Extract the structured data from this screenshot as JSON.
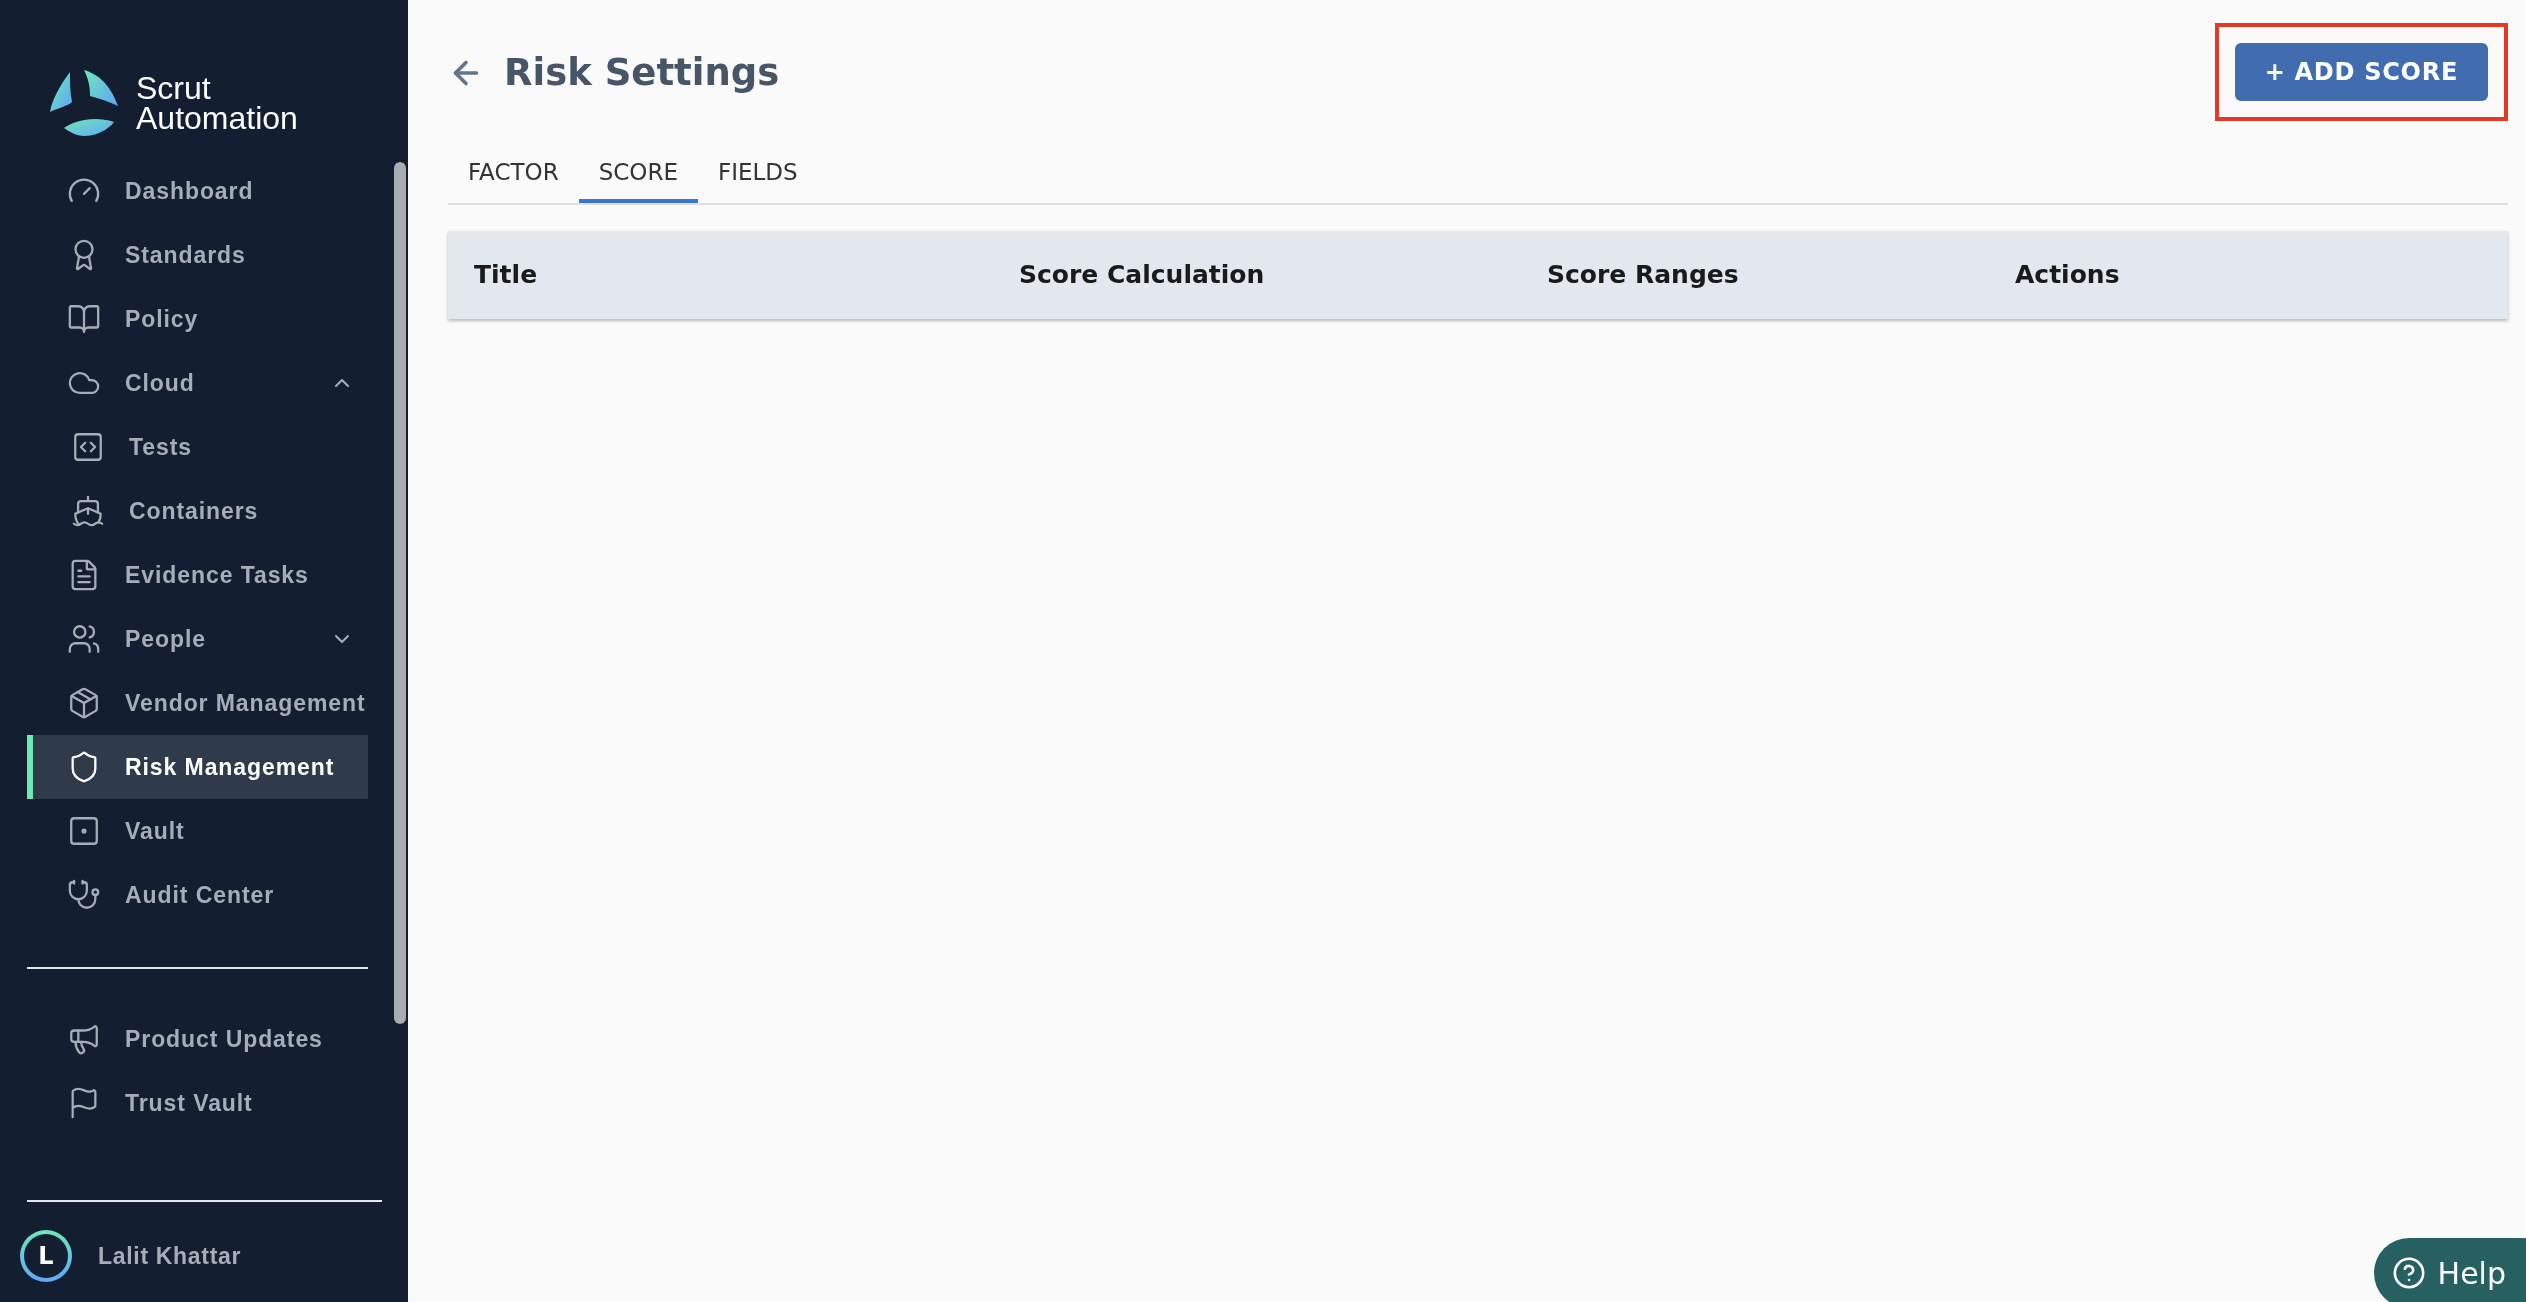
{
  "brand": {
    "line1": "Scrut",
    "line2": "Automation"
  },
  "sidebar": {
    "items": [
      {
        "label": "Dashboard",
        "selected": false
      },
      {
        "label": "Standards",
        "selected": false
      },
      {
        "label": "Policy",
        "selected": false
      },
      {
        "label": "Cloud",
        "selected": false,
        "expanded": true,
        "children": [
          {
            "label": "Tests",
            "selected": false
          },
          {
            "label": "Containers",
            "selected": false
          }
        ]
      },
      {
        "label": "Evidence Tasks",
        "selected": false
      },
      {
        "label": "People",
        "selected": false,
        "expanded": false
      },
      {
        "label": "Vendor Management",
        "selected": false
      },
      {
        "label": "Risk Management",
        "selected": true
      },
      {
        "label": "Vault",
        "selected": false
      },
      {
        "label": "Audit Center",
        "selected": false
      }
    ],
    "footer_items": [
      {
        "label": "Product Updates",
        "selected": false
      },
      {
        "label": "Trust Vault",
        "selected": false
      }
    ],
    "user": {
      "initial": "L",
      "name": "Lalit Khattar"
    }
  },
  "page": {
    "title": "Risk Settings",
    "add_button": "+ ADD SCORE"
  },
  "tabs": [
    {
      "label": "FACTOR",
      "selected": false
    },
    {
      "label": "SCORE",
      "selected": true
    },
    {
      "label": "FIELDS",
      "selected": false
    }
  ],
  "table": {
    "columns": [
      "Title",
      "Score Calculation",
      "Score Ranges",
      "Actions"
    ]
  },
  "help": {
    "label": "Help"
  }
}
